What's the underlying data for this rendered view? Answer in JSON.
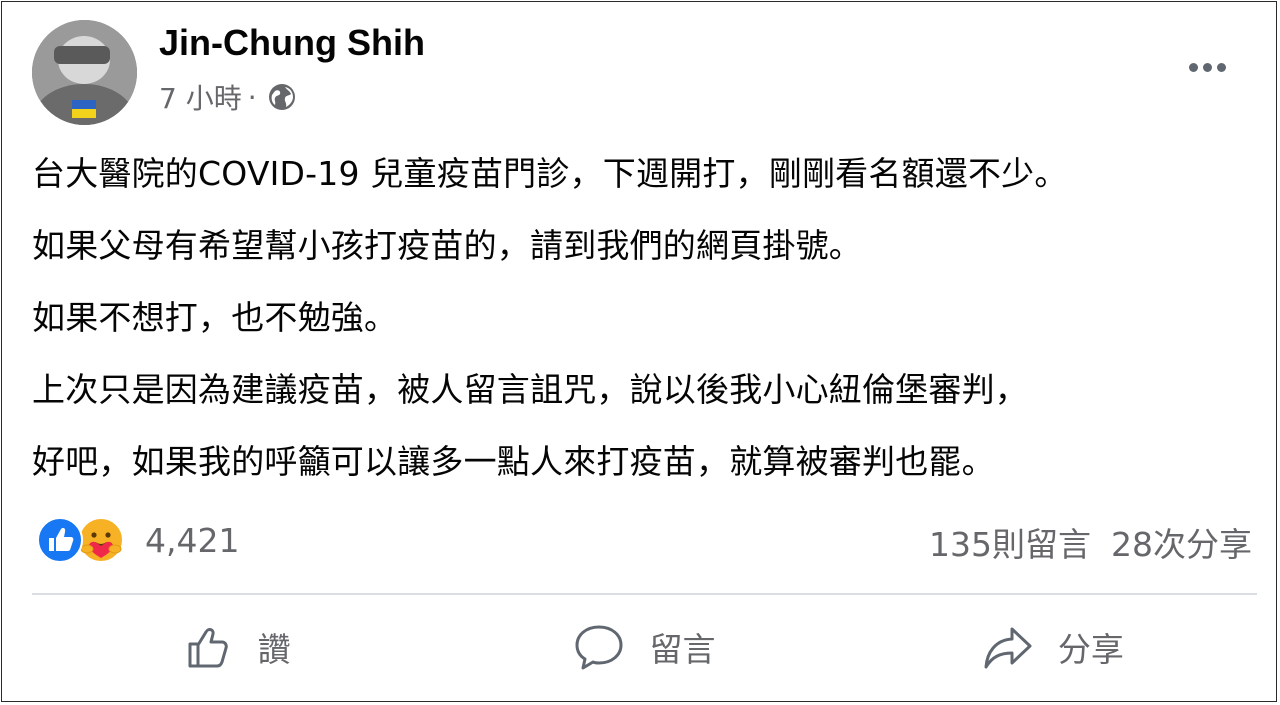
{
  "post": {
    "author": "Jin-Chung Shih",
    "time": "7 小時",
    "separator": "·",
    "body": [
      "台大醫院的COVID-19 兒童疫苗門診，下週開打，剛剛看名額還不少。",
      "如果父母有希望幫小孩打疫苗的，請到我們的網頁掛號。",
      "如果不想打，也不勉強。",
      "上次只是因為建議疫苗，被人留言詛咒，說以後我小心紐倫堡審判，",
      "好吧，如果我的呼籲可以讓多一點人來打疫苗，就算被審判也罷。"
    ]
  },
  "reactions": {
    "types": [
      "like-icon",
      "care-icon"
    ],
    "count": "4,421"
  },
  "stats": {
    "comments": "135則留言",
    "shares": "28次分享"
  },
  "actions": {
    "like_label": "讚",
    "comment_label": "留言",
    "share_label": "分享"
  },
  "colors": {
    "like_blue": "#1877f2",
    "care_yellow": "#f7b125",
    "care_red": "#f02849",
    "secondary_text": "#65676b",
    "divider": "#dadde1"
  }
}
